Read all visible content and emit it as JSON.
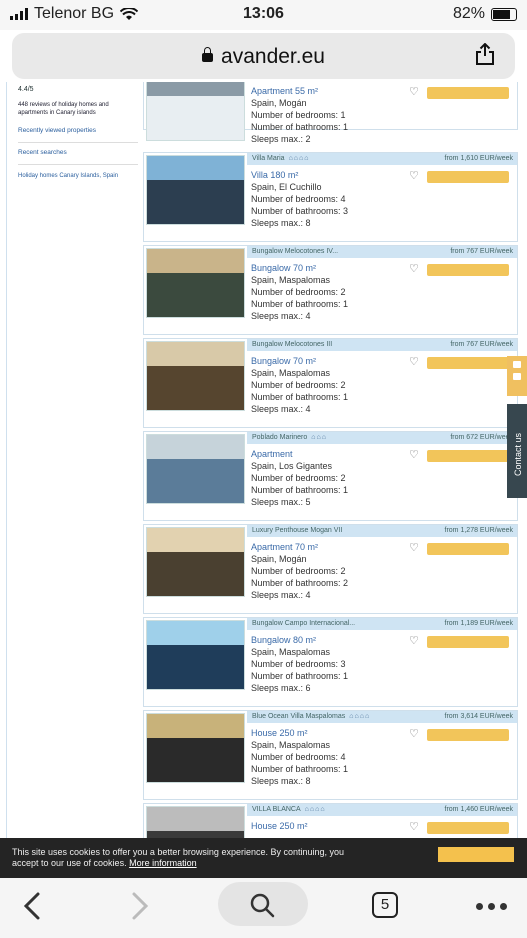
{
  "status": {
    "carrier": "Telenor BG",
    "time": "13:06",
    "battery": "82%"
  },
  "browser": {
    "url": "avander.eu",
    "tabs_count": "5"
  },
  "sidebar": {
    "rating": "4.4/5",
    "reviews": "448 reviews of holiday homes and apartments in Canary islands",
    "recently_viewed": "Recently viewed properties",
    "recent_searches": "Recent searches",
    "search_item": "Holiday homes Canary Islands, Spain"
  },
  "listings": [
    {
      "name": "",
      "stars": "",
      "price": "",
      "type": "Apartment 55 m²",
      "location": "Spain, Mogán",
      "bedrooms": "Number of bedrooms: 1",
      "bathrooms": "Number of bathrooms: 1",
      "sleeps": "Sleeps max.: 2"
    },
    {
      "name": "Villa Maria",
      "stars": "⌂⌂⌂⌂",
      "price": "from 1,610 EUR/week",
      "type": "Villa 180 m²",
      "location": "Spain, El Cuchillo",
      "bedrooms": "Number of bedrooms: 4",
      "bathrooms": "Number of bathrooms: 3",
      "sleeps": "Sleeps max.: 8"
    },
    {
      "name": "Bungalow Melocotones IV...",
      "stars": "",
      "price": "from 767 EUR/week",
      "type": "Bungalow 70 m²",
      "location": "Spain, Maspalomas",
      "bedrooms": "Number of bedrooms: 2",
      "bathrooms": "Number of bathrooms: 1",
      "sleeps": "Sleeps max.: 4"
    },
    {
      "name": "Bungalow Melocotones III",
      "stars": "",
      "price": "from 767 EUR/week",
      "type": "Bungalow 70 m²",
      "location": "Spain, Maspalomas",
      "bedrooms": "Number of bedrooms: 2",
      "bathrooms": "Number of bathrooms: 1",
      "sleeps": "Sleeps max.: 4"
    },
    {
      "name": "Poblado Marinero",
      "stars": "⌂⌂⌂",
      "price": "from 672 EUR/week",
      "type": "Apartment",
      "location": "Spain, Los Gigantes",
      "bedrooms": "Number of bedrooms: 2",
      "bathrooms": "Number of bathrooms: 1",
      "sleeps": "Sleeps max.: 5"
    },
    {
      "name": "Luxury Penthouse Mogan VII",
      "stars": "",
      "price": "from 1,278 EUR/week",
      "type": "Apartment 70 m²",
      "location": "Spain, Mogán",
      "bedrooms": "Number of bedrooms: 2",
      "bathrooms": "Number of bathrooms: 2",
      "sleeps": "Sleeps max.: 4"
    },
    {
      "name": "Bungalow Campo Internacional...",
      "stars": "",
      "price": "from 1,189 EUR/week",
      "type": "Bungalow 80 m²",
      "location": "Spain, Maspalomas",
      "bedrooms": "Number of bedrooms: 3",
      "bathrooms": "Number of bathrooms: 1",
      "sleeps": "Sleeps max.: 6"
    },
    {
      "name": "Blue Ocean Villa Maspalomas",
      "stars": "⌂⌂⌂⌂",
      "price": "from 3,614 EUR/week",
      "type": "House 250 m²",
      "location": "Spain, Maspalomas",
      "bedrooms": "Number of bedrooms: 4",
      "bathrooms": "Number of bathrooms: 1",
      "sleeps": "Sleeps max.: 8"
    },
    {
      "name": "VILLA BLANCA",
      "stars": "⌂⌂⌂⌂",
      "price": "from 1,460 EUR/week",
      "type": "House 250 m²",
      "location": "",
      "bedrooms": "",
      "bathrooms": "",
      "sleeps": ""
    }
  ],
  "side_tab": {
    "contact": "Contact us"
  },
  "cookie": {
    "text": "This site uses cookies to offer you a better browsing experience. By continuing, you accept to our use of cookies.",
    "link": "More information"
  }
}
